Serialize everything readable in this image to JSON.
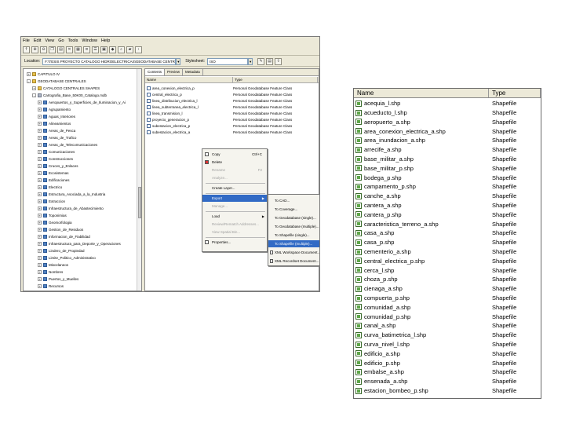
{
  "catalog": {
    "menu": [
      "File",
      "Edit",
      "View",
      "Go",
      "Tools",
      "Window",
      "Help"
    ],
    "location_label": "Location:",
    "location_value": "F:\\TESIS PROYECTO CATALOGO HIDROELECTRICAS\\GEODATABASE CENTRALES",
    "stylesheet_label": "Stylesheet:",
    "stylesheet_value": "ISO",
    "tree": [
      {
        "label": "CAPITULO IV",
        "indent": 0,
        "icon": "folder",
        "exp": "+"
      },
      {
        "label": "GEODATABASE CENTRALES",
        "indent": 0,
        "icon": "folder",
        "exp": "-"
      },
      {
        "label": "CATALOGO CENTRALES SHAPES",
        "indent": 1,
        "icon": "folder",
        "exp": "+"
      },
      {
        "label": "Cartografia_Base_50K00_Catalogo.mdb",
        "indent": 1,
        "icon": "gdb",
        "exp": "-"
      },
      {
        "label": "Aeropuertos_y_Superficies_de_Iluminacion_y_Ai",
        "indent": 2,
        "icon": "fc",
        "exp": "+"
      },
      {
        "label": "Agrupamiento",
        "indent": 2,
        "icon": "fc",
        "exp": "+"
      },
      {
        "label": "Aguas_Interiores",
        "indent": 2,
        "icon": "fc",
        "exp": "+"
      },
      {
        "label": "Alineamientos",
        "indent": 2,
        "icon": "fc",
        "exp": "+"
      },
      {
        "label": "Areas_de_Pesca",
        "indent": 2,
        "icon": "fc",
        "exp": "+"
      },
      {
        "label": "Areas_de_Trafico",
        "indent": 2,
        "icon": "fc",
        "exp": "+"
      },
      {
        "label": "Areas_de_Telecomunicaciones",
        "indent": 2,
        "icon": "fc",
        "exp": "+"
      },
      {
        "label": "Comunicaciones",
        "indent": 2,
        "icon": "fc",
        "exp": "+"
      },
      {
        "label": "Construcciones",
        "indent": 2,
        "icon": "fc",
        "exp": "+"
      },
      {
        "label": "Cruces_y_Enlaces",
        "indent": 2,
        "icon": "fc",
        "exp": "+"
      },
      {
        "label": "Ecosistemas",
        "indent": 2,
        "icon": "fc",
        "exp": "+"
      },
      {
        "label": "Edificaciones",
        "indent": 2,
        "icon": "fc",
        "exp": "+"
      },
      {
        "label": "Electrico",
        "indent": 2,
        "icon": "fc",
        "exp": "+"
      },
      {
        "label": "Estructura_Asociada_a_la_Industria",
        "indent": 2,
        "icon": "fc",
        "exp": "+"
      },
      {
        "label": "Extraccion",
        "indent": 2,
        "icon": "fc",
        "exp": "+"
      },
      {
        "label": "Infraestructura_de_Abastecimiento",
        "indent": 2,
        "icon": "fc",
        "exp": "+"
      },
      {
        "label": "Toponimias",
        "indent": 2,
        "icon": "fc",
        "exp": "+"
      },
      {
        "label": "Geomorfologia",
        "indent": 2,
        "icon": "fc",
        "exp": "+"
      },
      {
        "label": "Gestion_de_Residuos",
        "indent": 2,
        "icon": "fc",
        "exp": "+"
      },
      {
        "label": "Informacion_de_Fiabilidad",
        "indent": 2,
        "icon": "fc",
        "exp": "+"
      },
      {
        "label": "Infraestructura_para_Deporte_y_Operaciones",
        "indent": 2,
        "icon": "fc",
        "exp": "+"
      },
      {
        "label": "Lindero_de_Propiedad",
        "indent": 2,
        "icon": "fc",
        "exp": "+"
      },
      {
        "label": "Limite_Politico_Administrativo",
        "indent": 2,
        "icon": "fc",
        "exp": "+"
      },
      {
        "label": "Miscelaneos",
        "indent": 2,
        "icon": "fc",
        "exp": "+"
      },
      {
        "label": "Nombres",
        "indent": 2,
        "icon": "fc",
        "exp": "+"
      },
      {
        "label": "Puertos_y_Muelles",
        "indent": 2,
        "icon": "fc",
        "exp": "+"
      },
      {
        "label": "Recursos",
        "indent": 2,
        "icon": "fc",
        "exp": "+"
      }
    ],
    "tabs": [
      "Contents",
      "Preview",
      "Metadata"
    ],
    "columns": [
      "Name",
      "Type"
    ],
    "contents": [
      {
        "name": "area_conexion_electrica_p",
        "type": "Personal Geodatabase Feature Class"
      },
      {
        "name": "central_electrica_p",
        "type": "Personal Geodatabase Feature Class"
      },
      {
        "name": "linea_distribucion_electrica_l",
        "type": "Personal Geodatabase Feature Class"
      },
      {
        "name": "linea_subterranea_electrica_l",
        "type": "Personal Geodatabase Feature Class"
      },
      {
        "name": "linea_transmision_l",
        "type": "Personal Geodatabase Feature Class"
      },
      {
        "name": "proyecto_generacion_p",
        "type": "Personal Geodatabase Feature Class"
      },
      {
        "name": "subestacion_electrica_p",
        "type": "Personal Geodatabase Feature Class"
      },
      {
        "name": "subestacion_electrica_a",
        "type": "Personal Geodatabase Feature Class"
      }
    ],
    "context_menu": [
      {
        "label": "Copy",
        "shortcut": "Ctrl+C",
        "disabled": false
      },
      {
        "label": "Delete",
        "shortcut": "",
        "disabled": false
      },
      {
        "label": "Rename",
        "shortcut": "F2",
        "disabled": true
      },
      {
        "label": "Analyze...",
        "shortcut": "",
        "disabled": true
      },
      {
        "label": "Create Layer...",
        "shortcut": "",
        "disabled": false
      },
      {
        "label": "Export",
        "shortcut": "",
        "disabled": false,
        "submenu": true,
        "highlight": true
      },
      {
        "label": "Manage...",
        "shortcut": "",
        "disabled": true
      },
      {
        "label": "Load",
        "shortcut": "",
        "disabled": false,
        "submenu": true
      },
      {
        "label": "Review/Rematch Addresses...",
        "shortcut": "",
        "disabled": true
      },
      {
        "label": "View Spatial Bin...",
        "shortcut": "",
        "disabled": true
      },
      {
        "label": "Properties...",
        "shortcut": "",
        "disabled": false
      }
    ],
    "export_submenu": [
      {
        "label": "To CAD..."
      },
      {
        "label": "To Coverage..."
      },
      {
        "label": "To Geodatabase (single)..."
      },
      {
        "label": "To Geodatabase (multiple)..."
      },
      {
        "label": "To Shapefile (single)..."
      },
      {
        "label": "To Shapefile (multiple)...",
        "highlight": true
      },
      {
        "label": "XML Workspace Document..."
      },
      {
        "label": "XML Recordset Document..."
      }
    ]
  },
  "shapefiles": {
    "columns": [
      "Name",
      "Type"
    ],
    "rows": [
      {
        "name": "acequia_l.shp",
        "type": "Shapefile"
      },
      {
        "name": "acueducto_l.shp",
        "type": "Shapefile"
      },
      {
        "name": "aeropuerto_a.shp",
        "type": "Shapefile"
      },
      {
        "name": "area_conexion_electrica_a.shp",
        "type": "Shapefile"
      },
      {
        "name": "area_inundacion_a.shp",
        "type": "Shapefile"
      },
      {
        "name": "arrecife_a.shp",
        "type": "Shapefile"
      },
      {
        "name": "base_militar_a.shp",
        "type": "Shapefile"
      },
      {
        "name": "base_militar_p.shp",
        "type": "Shapefile"
      },
      {
        "name": "bodega_p.shp",
        "type": "Shapefile"
      },
      {
        "name": "campamento_p.shp",
        "type": "Shapefile"
      },
      {
        "name": "canche_a.shp",
        "type": "Shapefile"
      },
      {
        "name": "cantera_a.shp",
        "type": "Shapefile"
      },
      {
        "name": "cantera_p.shp",
        "type": "Shapefile"
      },
      {
        "name": "caracteristica_terreno_a.shp",
        "type": "Shapefile"
      },
      {
        "name": "casa_a.shp",
        "type": "Shapefile"
      },
      {
        "name": "casa_p.shp",
        "type": "Shapefile"
      },
      {
        "name": "cementerio_a.shp",
        "type": "Shapefile"
      },
      {
        "name": "central_electrica_p.shp",
        "type": "Shapefile"
      },
      {
        "name": "cerca_l.shp",
        "type": "Shapefile"
      },
      {
        "name": "choza_p.shp",
        "type": "Shapefile"
      },
      {
        "name": "cienaga_a.shp",
        "type": "Shapefile"
      },
      {
        "name": "compuerta_p.shp",
        "type": "Shapefile"
      },
      {
        "name": "comunidad_a.shp",
        "type": "Shapefile"
      },
      {
        "name": "comunidad_p.shp",
        "type": "Shapefile"
      },
      {
        "name": "canal_a.shp",
        "type": "Shapefile"
      },
      {
        "name": "curva_batimetrica_l.shp",
        "type": "Shapefile"
      },
      {
        "name": "curva_nivel_l.shp",
        "type": "Shapefile"
      },
      {
        "name": "edificio_a.shp",
        "type": "Shapefile"
      },
      {
        "name": "edificio_p.shp",
        "type": "Shapefile"
      },
      {
        "name": "embalse_a.shp",
        "type": "Shapefile"
      },
      {
        "name": "ensenada_a.shp",
        "type": "Shapefile"
      },
      {
        "name": "estacion_bombeo_p.shp",
        "type": "Shapefile"
      }
    ]
  }
}
